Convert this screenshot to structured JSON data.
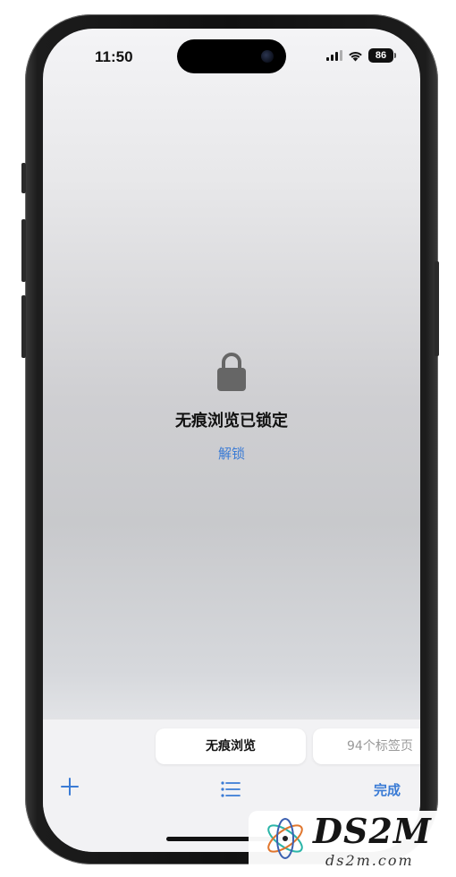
{
  "status_bar": {
    "time": "11:50",
    "battery": "86"
  },
  "lock_screen": {
    "title": "无痕浏览已锁定",
    "unlock_label": "解锁"
  },
  "tab_switcher": {
    "active_tab_label": "无痕浏览",
    "other_tab_label": "94个标签页"
  },
  "toolbar": {
    "add_icon": "plus-icon",
    "list_icon": "list-icon",
    "done_label": "完成"
  },
  "watermark": {
    "brand": "DS2M",
    "url": "ds2m.com"
  },
  "colors": {
    "accent": "#3a7bd5",
    "lock_icon": "#666666"
  }
}
